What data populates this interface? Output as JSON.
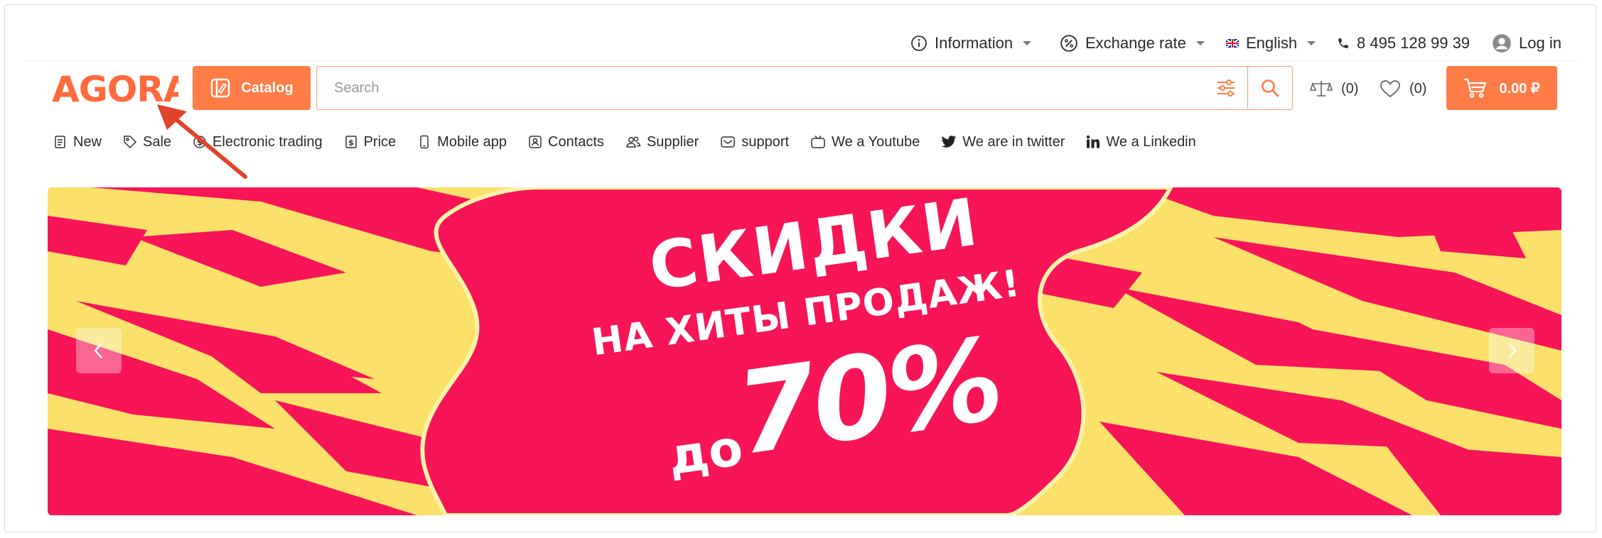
{
  "topbar": {
    "information": "Information",
    "exchange_rate": "Exchange rate",
    "language": "English",
    "phone": "8 495 128 99 39",
    "login": "Log in"
  },
  "header": {
    "logo_text": "AGORA",
    "catalog_label": "Catalog",
    "search_placeholder": "Search",
    "compare_count": "(0)",
    "wishlist_count": "(0)",
    "cart_total": "0.00 ₽"
  },
  "nav": {
    "items": [
      {
        "label": "New",
        "icon": "document-icon"
      },
      {
        "label": "Sale",
        "icon": "tag-icon"
      },
      {
        "label": "Electronic trading",
        "icon": "dollar-circle-icon"
      },
      {
        "label": "Price",
        "icon": "price-list-icon"
      },
      {
        "label": "Mobile app",
        "icon": "phone-icon"
      },
      {
        "label": "Contacts",
        "icon": "contact-card-icon"
      },
      {
        "label": "Supplier",
        "icon": "users-icon"
      },
      {
        "label": "support",
        "icon": "mail-icon"
      },
      {
        "label": "We a Youtube",
        "icon": "tv-icon"
      },
      {
        "label": "We are in twitter",
        "icon": "twitter-icon"
      },
      {
        "label": "We a Linkedin",
        "icon": "linkedin-icon"
      }
    ]
  },
  "banner": {
    "title": "СКИДКИ",
    "subtitle": "НА ХИТЫ ПРОДАЖ!",
    "prefix": "до",
    "discount": "70%"
  },
  "colors": {
    "accent": "#ff7c47",
    "banner_pink": "#f71558",
    "banner_yellow": "#fbe06a",
    "annotation_red": "#e0442c"
  }
}
